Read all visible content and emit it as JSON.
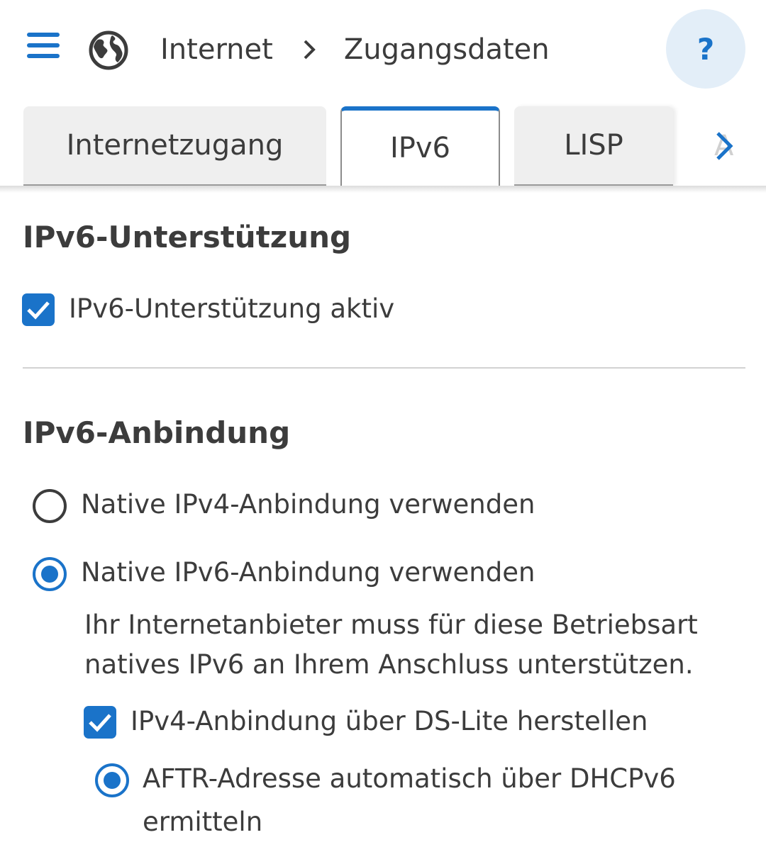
{
  "header": {
    "menu_icon": "hamburger-menu-icon",
    "globe_icon": "globe-icon",
    "breadcrumb": [
      "Internet",
      "Zugangsdaten"
    ],
    "help_label": "?"
  },
  "tabs": [
    {
      "label": "Internetzugang",
      "active": false
    },
    {
      "label": "IPv6",
      "active": true
    },
    {
      "label": "LISP",
      "active": false
    },
    {
      "label": "A",
      "active": false
    }
  ],
  "support": {
    "title": "IPv6-Unterstützung",
    "checkbox_label": "IPv6-Unterstützung aktiv",
    "checked": true
  },
  "connection": {
    "title": "IPv6-Anbindung",
    "options": [
      {
        "label": "Native IPv4-Anbindung verwenden",
        "selected": false
      },
      {
        "label": "Native IPv6-Anbindung verwenden",
        "selected": true
      }
    ],
    "description": "Ihr Internetanbieter muss für diese Betriebsart natives IPv6 an Ihrem Anschluss unterstützen.",
    "ds_lite": {
      "label": "IPv4-Anbindung über DS-Lite herstellen",
      "checked": true
    },
    "aftr": {
      "line1": "AFTR-Adresse automatisch über DHCPv6",
      "line2": "ermitteln",
      "selected": true
    }
  },
  "colors": {
    "accent": "#1a73c9",
    "text": "#3c3c3c",
    "tab_bg": "#efefef",
    "help_bg": "#e3eef8"
  }
}
